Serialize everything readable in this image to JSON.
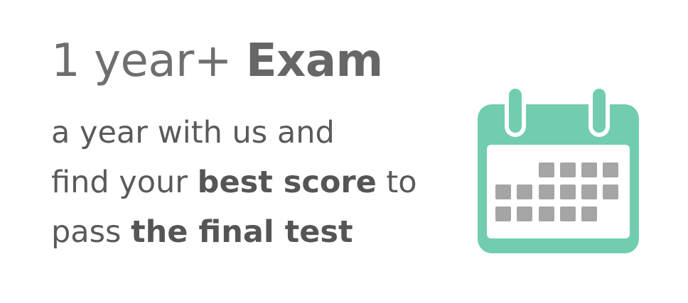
{
  "headline": {
    "prefix": "1 year+",
    "emphasis": "Exam"
  },
  "lines": [
    {
      "before": "a year with us and",
      "strong": "",
      "after": ""
    },
    {
      "before": "find your",
      "strong": "best score",
      "after": "to"
    },
    {
      "before": "pass",
      "strong": "the final test",
      "after": ""
    }
  ],
  "icon": {
    "name": "calendar-icon",
    "frame_color": "#72cdb0",
    "day_color": "#a5a5a5",
    "page_color": "#ffffff"
  }
}
